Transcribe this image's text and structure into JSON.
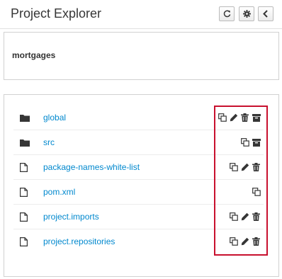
{
  "header": {
    "title": "Project Explorer",
    "buttons": [
      {
        "icon": "refresh-icon"
      },
      {
        "icon": "gear-icon"
      },
      {
        "icon": "chevron-left-icon"
      }
    ]
  },
  "project": {
    "name": "mortgages"
  },
  "files": [
    {
      "name": "global",
      "type": "folder",
      "actions": [
        "copy-icon",
        "pencil-icon",
        "trash-icon",
        "archive-icon"
      ]
    },
    {
      "name": "src",
      "type": "folder",
      "actions": [
        "copy-icon",
        "archive-icon"
      ]
    },
    {
      "name": "package-names-white-list",
      "type": "file",
      "actions": [
        "copy-icon",
        "pencil-icon",
        "trash-icon"
      ]
    },
    {
      "name": "pom.xml",
      "type": "file",
      "actions": [
        "copy-icon"
      ]
    },
    {
      "name": "project.imports",
      "type": "file",
      "actions": [
        "copy-icon",
        "pencil-icon",
        "trash-icon"
      ]
    },
    {
      "name": "project.repositories",
      "type": "file",
      "actions": [
        "copy-icon",
        "pencil-icon",
        "trash-icon"
      ]
    }
  ],
  "colors": {
    "link": "#0088ce",
    "highlight": "#c8102e",
    "icon": "#363636"
  }
}
